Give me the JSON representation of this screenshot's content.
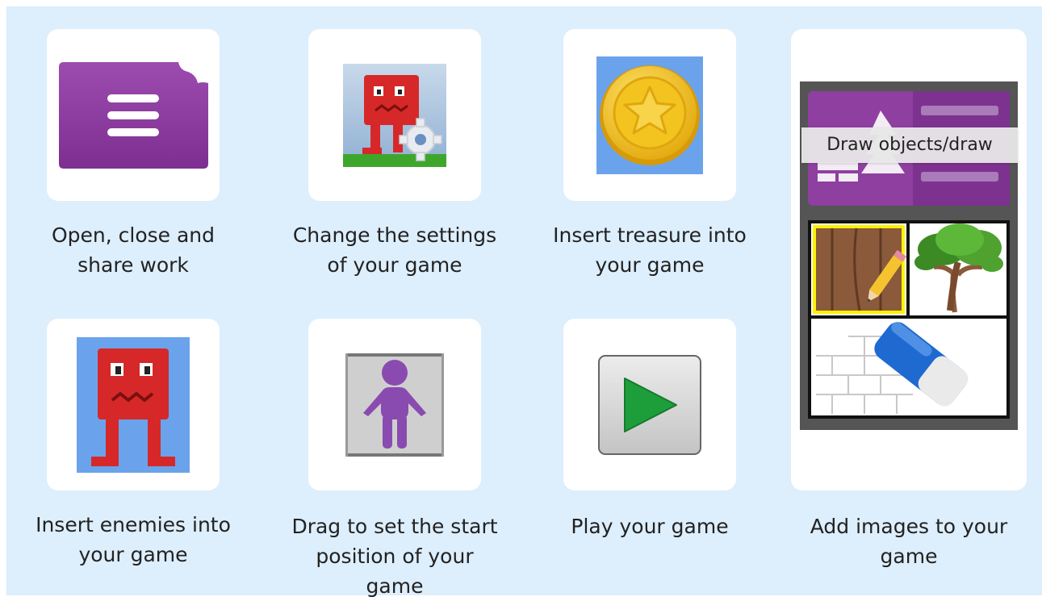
{
  "tiles": [
    {
      "label": "Open, close and\nshare work",
      "icon": "open-close-share-icon"
    },
    {
      "label": "Change the settings\nof your game",
      "icon": "settings-icon"
    },
    {
      "label": "Insert treasure into\nyour game",
      "icon": "treasure-coin-icon"
    },
    {
      "label": "Insert enemies into\nyour game",
      "icon": "enemy-icon"
    },
    {
      "label": "Drag to set the start\nposition of your\ngame",
      "icon": "start-position-icon"
    },
    {
      "label": "Play your game",
      "icon": "play-icon"
    },
    {
      "label": "Add images to your\ngame",
      "icon": "draw-images-icon"
    }
  ],
  "tooltip": "Draw objects/draw",
  "colors": {
    "background": "#ddeefc",
    "purple": "#8e3fa0",
    "enemy_red": "#d62828",
    "coin_gold": "#f2c318",
    "play_green": "#1e9e3a"
  }
}
